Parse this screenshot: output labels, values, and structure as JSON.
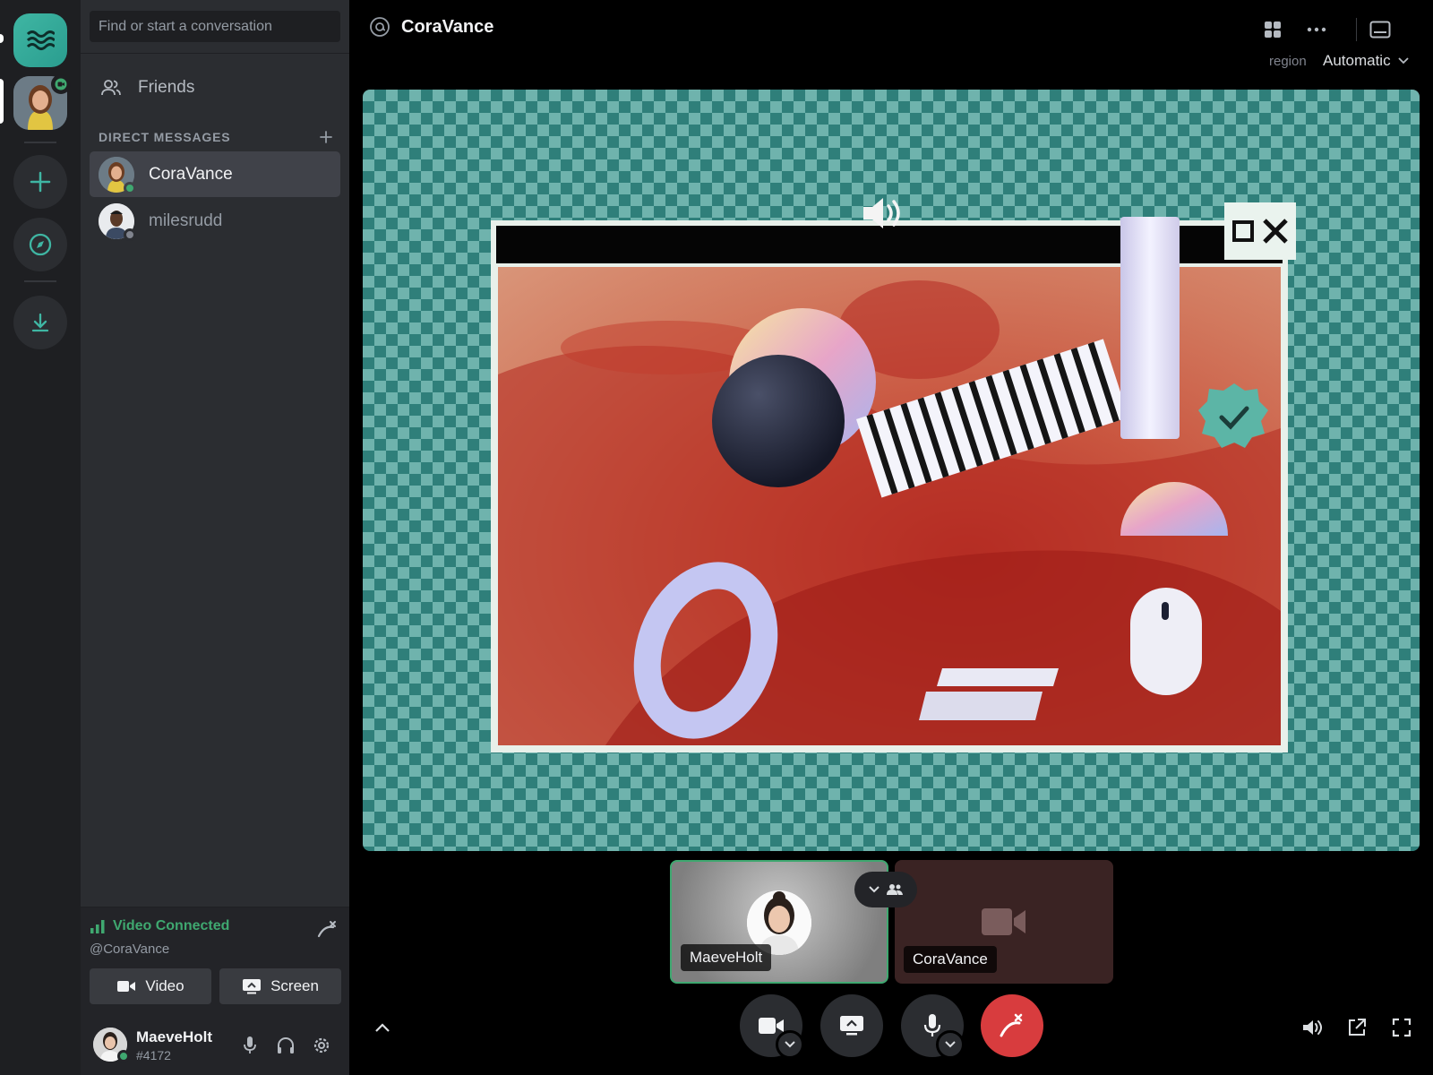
{
  "sidebar": {
    "search_placeholder": "Find or start a conversation",
    "friends_label": "Friends",
    "dm_header": "DIRECT MESSAGES",
    "dms": [
      {
        "name": "CoraVance",
        "status": "online",
        "active": true
      },
      {
        "name": "milesrudd",
        "status": "offline",
        "active": false
      }
    ]
  },
  "voice": {
    "status": "Video Connected",
    "channel": "@CoraVance",
    "video_button": "Video",
    "screen_button": "Screen"
  },
  "user": {
    "name": "MaeveHolt",
    "tag": "#4172"
  },
  "call": {
    "title": "CoraVance",
    "region_label": "region",
    "region_value": "Automatic",
    "tiles": [
      {
        "name": "MaeveHolt",
        "speaking": true
      },
      {
        "name": "CoraVance",
        "camera": "off"
      }
    ]
  },
  "colors": {
    "accent": "#3fb6a3",
    "online": "#3fa870",
    "end_call": "#d83c3e",
    "sidebar": "#2b2d31",
    "rail": "#1e1f22"
  },
  "icons": {
    "home": "waves-icon",
    "add_server": "plus-icon",
    "explore": "compass-icon",
    "download": "download-icon",
    "layout": "grid-icon",
    "more": "more-horizontal-icon",
    "inbox": "monitor-icon"
  }
}
